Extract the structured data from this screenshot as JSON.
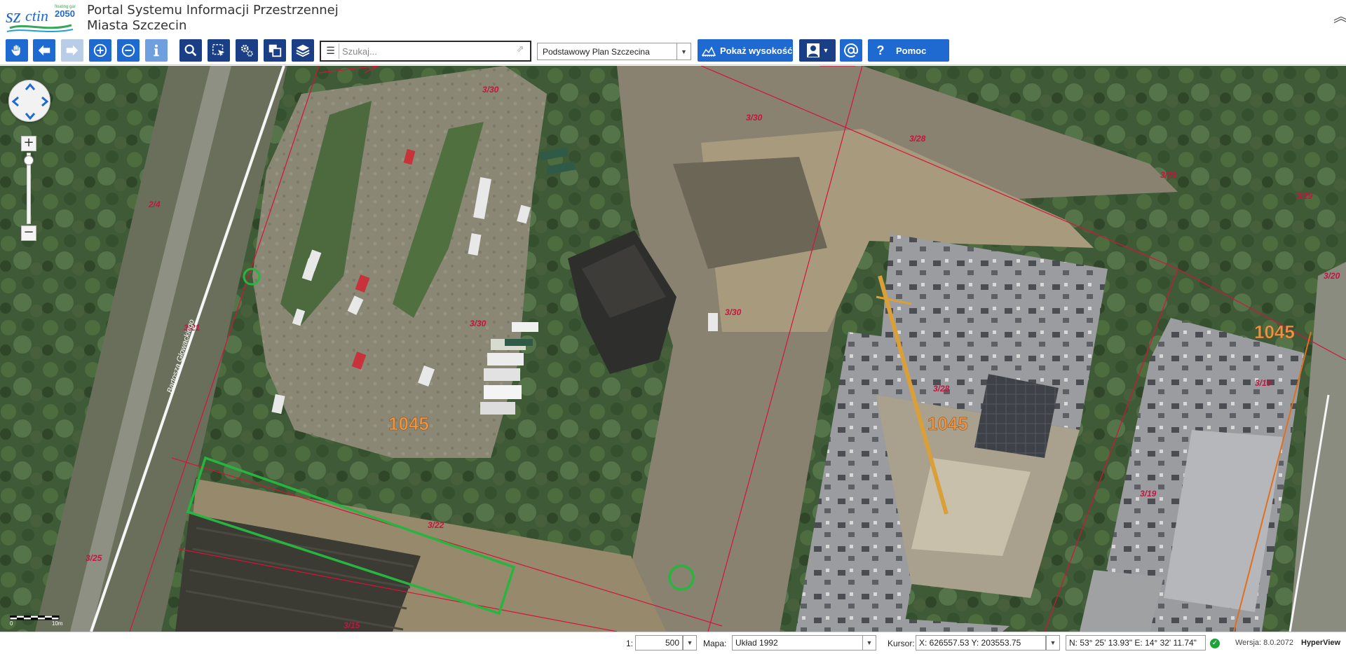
{
  "header": {
    "title": "Portal Systemu Informacji Przestrzennej",
    "subtitle": "Miasta Szczecin",
    "logo_text": "szczecin 2050",
    "logo_tagline": "floating garden"
  },
  "toolbar": {
    "tools": [
      {
        "name": "pan-tool",
        "icon": "hand-icon"
      },
      {
        "name": "back-tool",
        "icon": "arrow-left-icon"
      },
      {
        "name": "forward-tool",
        "icon": "arrow-right-icon"
      },
      {
        "name": "zoom-in-tool",
        "icon": "zoom-in-icon"
      },
      {
        "name": "zoom-out-tool",
        "icon": "zoom-out-icon"
      },
      {
        "name": "info-tool",
        "icon": "info-icon"
      },
      {
        "name": "search-tool",
        "icon": "magnifier-icon"
      },
      {
        "name": "select-tool",
        "icon": "selection-icon"
      },
      {
        "name": "settings-tool",
        "icon": "gears-icon"
      },
      {
        "name": "windows-tool",
        "icon": "windows-icon"
      },
      {
        "name": "layers-tool",
        "icon": "layers-icon"
      }
    ],
    "search": {
      "placeholder": "Szukaj..."
    },
    "map_select": {
      "value": "Podstawowy Plan Szczecina"
    },
    "height_button": "Pokaż wysokość",
    "help_button": "Pomoc",
    "accent": "#1f6ad1",
    "accent_dark": "#1a3f86"
  },
  "map": {
    "parcel_labels": [
      "3/30",
      "3/30",
      "3/28",
      "3/29",
      "3/29",
      "3/20",
      "2/4",
      "3/30",
      "3/30",
      "3/28",
      "3/19",
      "3/19",
      "3/22",
      "3/25",
      "3/15",
      "3/21"
    ],
    "district_labels": [
      "1045",
      "1045",
      "1045"
    ],
    "street_label": "Bartosza Głowackiego",
    "parcel_line_color": "#d4143a",
    "highlight_color": "#27b540",
    "district_label_color": "#e8954a",
    "scale_labels": [
      "0",
      "10m"
    ]
  },
  "status": {
    "scale_prefix": "1:",
    "scale_value": "500",
    "map_label": "Mapa:",
    "crs_value": "Układ 1992",
    "cursor_label": "Kursor:",
    "cursor_value": "X: 626557.53  Y: 203553.75",
    "geo_value": "N: 53° 25' 13.93\"  E: 14° 32' 11.74\"",
    "version": "Wersja: 8.0.2072",
    "brand": "HyperView"
  }
}
